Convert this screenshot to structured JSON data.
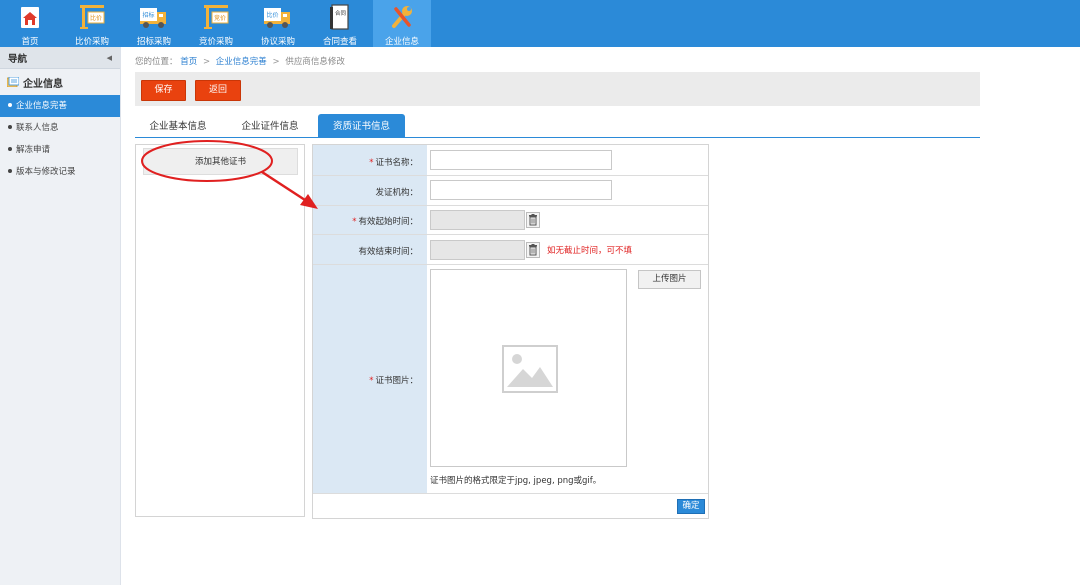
{
  "topnav": {
    "items": [
      {
        "label": "首页",
        "icon": "home-icon",
        "badge": ""
      },
      {
        "label": "比价采购",
        "icon": "crane-icon",
        "badge": "比价"
      },
      {
        "label": "招标采购",
        "icon": "truck-icon",
        "badge": "招标"
      },
      {
        "label": "竞价采购",
        "icon": "crane-icon",
        "badge": "竞价"
      },
      {
        "label": "协议采购",
        "icon": "truck-icon",
        "badge": "比价"
      },
      {
        "label": "合同查看",
        "icon": "contract-icon",
        "badge": "合同"
      },
      {
        "label": "企业信息",
        "icon": "wrench-icon",
        "badge": ""
      }
    ],
    "active_index": 6
  },
  "sidebar": {
    "title": "导航",
    "collapse_glyph": "◀",
    "group": "企业信息",
    "items": [
      {
        "label": "企业信息完善",
        "active": true
      },
      {
        "label": "联系人信息",
        "active": false
      },
      {
        "label": "解冻申请",
        "active": false
      },
      {
        "label": "版本与修改记录",
        "active": false
      }
    ]
  },
  "breadcrumb": {
    "prefix": "您的位置：",
    "home": "首页",
    "sep": ">",
    "section": "企业信息完善",
    "current": "供应商信息修改"
  },
  "toolbar": {
    "save_label": "保存",
    "back_label": "返回"
  },
  "tabs": [
    {
      "label": "企业基本信息",
      "active": false
    },
    {
      "label": "企业证件信息",
      "active": false
    },
    {
      "label": "资质证书信息",
      "active": true
    }
  ],
  "left_panel": {
    "add_cert_label": "添加其他证书"
  },
  "form": {
    "required_mark": "*",
    "cert_name_label": "证书名称：",
    "cert_name_value": "",
    "issuer_label": "发证机构：",
    "issuer_value": "",
    "valid_start_label": "有效起始时间：",
    "valid_start_value": "",
    "valid_end_label": "有效结束时间：",
    "valid_end_value": "",
    "valid_end_hint": "如无截止时间，可不填",
    "cert_image_label": "证书图片：",
    "upload_label": "上传图片",
    "format_note": "证书图片的格式限定于jpg, jpeg, png或gif。",
    "confirm_label": "确定"
  },
  "colors": {
    "nav_blue": "#2b8ad8",
    "nav_active": "#4aa3ea",
    "action_red": "#e9420f",
    "label_bg": "#dbe8f4",
    "annotation_red": "#e02020"
  }
}
